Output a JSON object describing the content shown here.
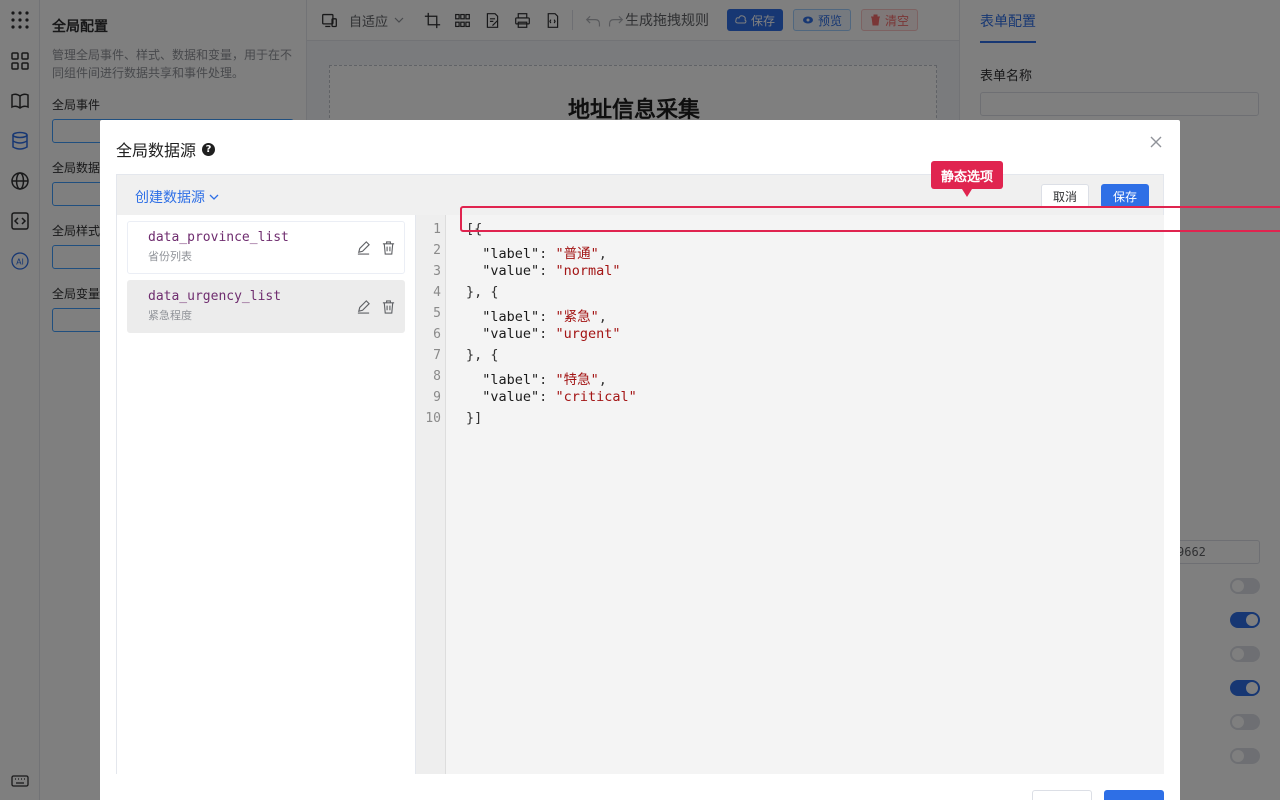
{
  "global_panel": {
    "title": "全局配置",
    "description": "管理全局事件、样式、数据和变量，用于在不同组件间进行数据共享和事件处理。",
    "items": [
      "全局事件",
      "全局数据",
      "全局样式",
      "全局变量"
    ]
  },
  "toolbar": {
    "device_select": "自适应",
    "generate_rules": "生成拖拽规则",
    "save": "保存",
    "preview": "预览",
    "clear": "清空"
  },
  "canvas": {
    "form_title": "地址信息采集"
  },
  "right_panel": {
    "tab": "表单配置",
    "form_name_label": "表单名称",
    "partial_value": "9662"
  },
  "modal": {
    "title": "全局数据源",
    "help": "?",
    "create_datasource": "创建数据源",
    "cancel": "取消",
    "save": "保存",
    "datasources": [
      {
        "name": "data_province_list",
        "desc": "省份列表",
        "active": false
      },
      {
        "name": "data_urgency_list",
        "desc": "紧急程度",
        "active": true
      }
    ],
    "line_numbers": [
      "1",
      "2",
      "3",
      "4",
      "5",
      "6",
      "7",
      "8",
      "9",
      "10"
    ],
    "code": [
      "[{",
      "  \"label\": \"普通\",",
      "  \"value\": \"normal\"",
      "}, {",
      "  \"label\": \"紧急\",",
      "  \"value\": \"urgent\"",
      "}, {",
      "  \"label\": \"特急\",",
      "  \"value\": \"critical\"",
      "}]"
    ]
  },
  "annotation": {
    "tooltip": "静态选项"
  },
  "colors": {
    "primary": "#2e6fe6",
    "highlight": "#e0244f",
    "string": "#a31515",
    "datasource_name": "#6f2d6f"
  }
}
